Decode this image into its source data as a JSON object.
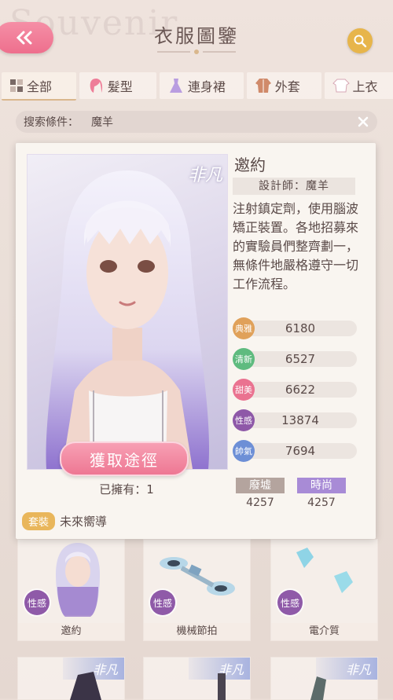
{
  "header": {
    "title": "衣服圖鑒",
    "watermark": "Souvenir"
  },
  "tabs": [
    {
      "label": "全部",
      "icon": "grid-icon",
      "active": true
    },
    {
      "label": "髮型",
      "icon": "hair-icon",
      "active": false
    },
    {
      "label": "連身裙",
      "icon": "dress-icon",
      "active": false
    },
    {
      "label": "外套",
      "icon": "coat-icon",
      "active": false
    },
    {
      "label": "上衣",
      "icon": "shirt-icon",
      "active": false
    }
  ],
  "filter": {
    "label": "搜索條件：",
    "value": "魔羊"
  },
  "detail": {
    "rarity": "非凡",
    "name": "邀約",
    "designer": "設計師：魔羊",
    "description": "注射鎮定劑，使用腦波矯正裝置。各地招募來的實驗員們整齊劃一，無條件地嚴格遵守一切工作流程。",
    "obtain_label": "獲取途徑",
    "owned": "已擁有：1",
    "set_badge": "套裝",
    "set_name": "未來嚮導",
    "attributes": [
      {
        "name": "典雅",
        "value": "6180",
        "color": "#e0a15a"
      },
      {
        "name": "清新",
        "value": "6527",
        "color": "#5fbb7f"
      },
      {
        "name": "甜美",
        "value": "6622",
        "color": "#ea7290"
      },
      {
        "name": "性感",
        "value": "13874",
        "color": "#8e58a8"
      },
      {
        "name": "帥氣",
        "value": "7694",
        "color": "#6d8fd6"
      }
    ],
    "tags": [
      {
        "name": "廢墟",
        "value": "4257",
        "color": "#b4a49e"
      },
      {
        "name": "時尚",
        "value": "4257",
        "color": "#a88bd6"
      }
    ]
  },
  "grid": [
    {
      "label": "邀約",
      "attr": "性感"
    },
    {
      "label": "機械節拍",
      "attr": "性感"
    },
    {
      "label": "電介質",
      "attr": "性感"
    }
  ],
  "grid_rarity": "非凡",
  "colors": {
    "accent_pink": "#ee7793",
    "gold": "#e7b54b",
    "purple": "#8e58a8"
  }
}
